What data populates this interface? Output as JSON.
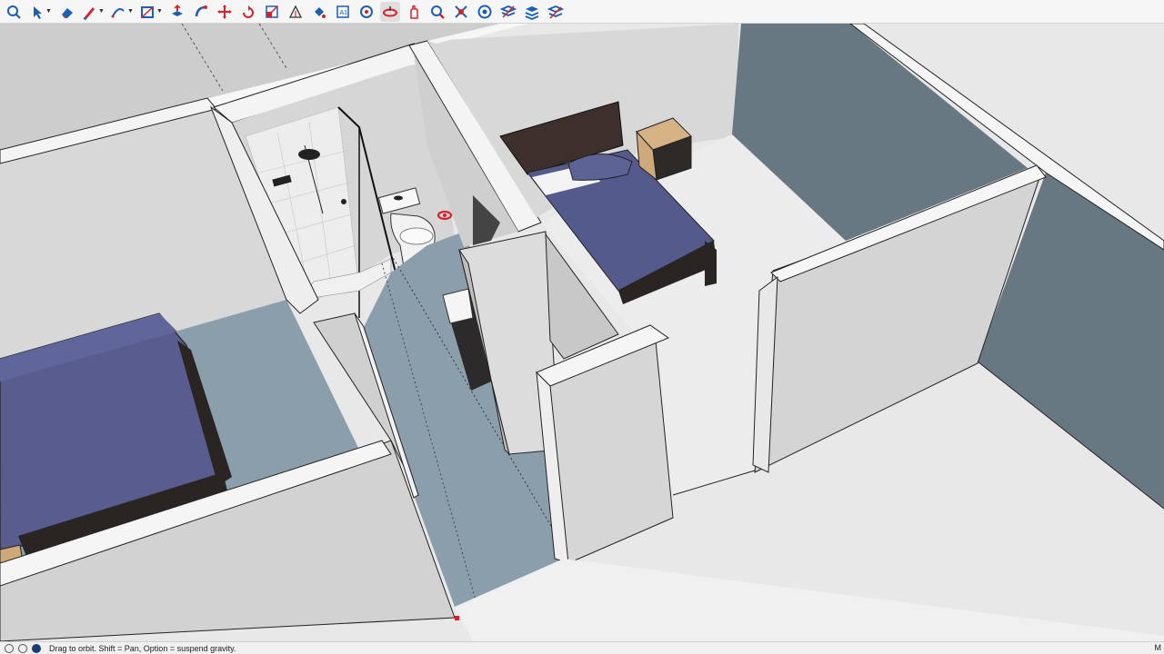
{
  "toolbar": {
    "tools": [
      {
        "name": "search-icon",
        "has_menu": false,
        "active": false
      },
      {
        "name": "select-arrow-icon",
        "has_menu": true,
        "active": false
      },
      {
        "name": "eraser-icon",
        "has_menu": false,
        "active": false
      },
      {
        "name": "pencil-line-icon",
        "has_menu": true,
        "active": false
      },
      {
        "name": "arc-icon",
        "has_menu": true,
        "active": false
      },
      {
        "name": "rectangle-icon",
        "has_menu": true,
        "active": false
      },
      {
        "name": "push-pull-icon",
        "has_menu": false,
        "active": false
      },
      {
        "name": "follow-me-icon",
        "has_menu": false,
        "active": false
      },
      {
        "name": "move-icon",
        "has_menu": false,
        "active": false
      },
      {
        "name": "rotate-icon",
        "has_menu": false,
        "active": false
      },
      {
        "name": "scale-icon",
        "has_menu": false,
        "active": false
      },
      {
        "name": "protractor-icon",
        "has_menu": false,
        "active": false
      },
      {
        "name": "paint-bucket-icon",
        "has_menu": false,
        "active": false
      },
      {
        "name": "text-tool-icon",
        "has_menu": false,
        "active": false
      },
      {
        "name": "position-camera-icon",
        "has_menu": false,
        "active": false
      },
      {
        "name": "orbit-icon",
        "has_menu": false,
        "active": true
      },
      {
        "name": "pan-icon",
        "has_menu": false,
        "active": false
      },
      {
        "name": "zoom-icon",
        "has_menu": false,
        "active": false
      },
      {
        "name": "zoom-extents-icon",
        "has_menu": false,
        "active": false
      },
      {
        "name": "section-plane-icon",
        "has_menu": false,
        "active": false
      },
      {
        "name": "tags-icon",
        "has_menu": false,
        "active": false
      },
      {
        "name": "layers-icon",
        "has_menu": false,
        "active": false
      },
      {
        "name": "display-sections-icon",
        "has_menu": false,
        "active": false
      }
    ]
  },
  "status": {
    "hint": "Drag to orbit. Shift = Pan, Option = suspend gravity.",
    "measurements_label": "M"
  },
  "colors": {
    "accent_blue": "#1a5fb4",
    "bed_blue": "#555a8c",
    "floor_blue": "#8a9fab",
    "wall_dark": "#6a7882",
    "wood": "#cfa979",
    "headboard": "#3d2f2b",
    "orbit_red": "#d6202a"
  }
}
